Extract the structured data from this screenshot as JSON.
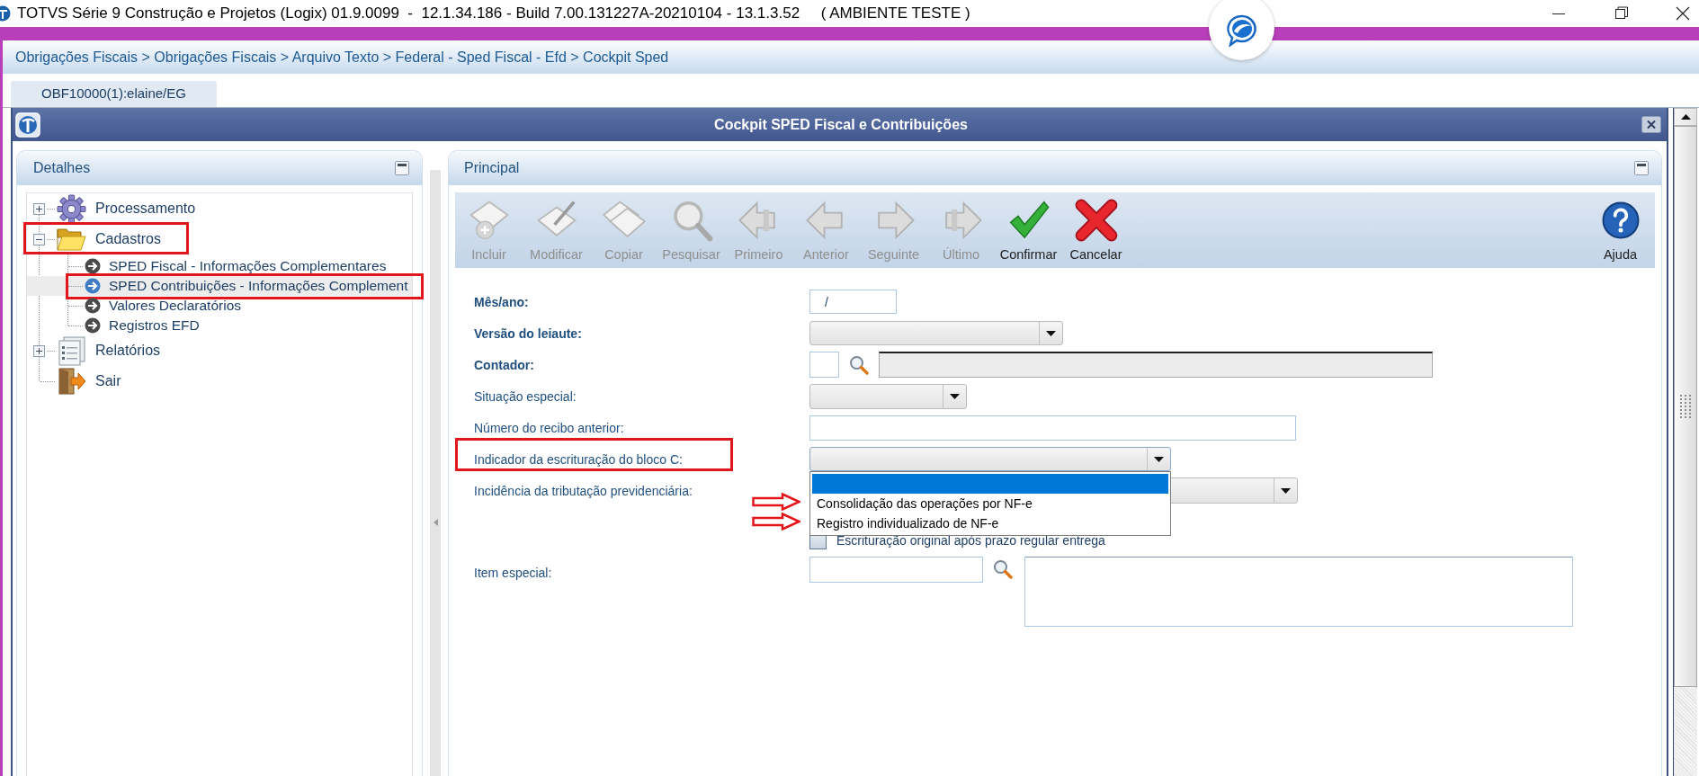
{
  "app_bar": {
    "title": "TOTVS Série 9 Construção e Projetos (Logix) 01.9.0099  -  12.1.34.186 - Build 7.00.131227A-20210104 - 13.1.3.52     ( AMBIENTE TESTE )"
  },
  "breadcrumb": "Obrigações Fiscais > Obrigações Fiscais > Arquivo Texto > Federal - Sped Fiscal - Efd > Cockpit Sped",
  "tabs": [
    {
      "label": "OBF10000(1):elaine/EG",
      "selected": true
    }
  ],
  "window": {
    "title": "Cockpit SPED Fiscal e Contribuições"
  },
  "details_panel": {
    "title": "Detalhes",
    "tree": [
      {
        "label": "Processamento",
        "expanded": false,
        "selected": false,
        "highlighted": false
      },
      {
        "label": "Cadastros",
        "expanded": true,
        "selected": false,
        "highlighted": true,
        "children": [
          {
            "label": "SPED Fiscal - Informações Complementares",
            "selected": false,
            "highlighted": false
          },
          {
            "label": "SPED Contribuições - Informações Complement",
            "selected": true,
            "highlighted": true
          },
          {
            "label": "Valores Declaratórios",
            "selected": false,
            "highlighted": false
          },
          {
            "label": "Registros EFD",
            "selected": false,
            "highlighted": false
          }
        ]
      },
      {
        "label": "Relatórios",
        "expanded": false,
        "selected": false,
        "highlighted": false
      },
      {
        "label": "Sair",
        "selected": false,
        "highlighted": false
      }
    ]
  },
  "main_panel": {
    "title": "Principal",
    "toolbar": [
      {
        "label": "Incluir",
        "disabled": true
      },
      {
        "label": "Modificar",
        "disabled": true
      },
      {
        "label": "Copiar",
        "disabled": true
      },
      {
        "label": "Pesquisar",
        "disabled": true
      },
      {
        "label": "Primeiro",
        "disabled": true
      },
      {
        "label": "Anterior",
        "disabled": true
      },
      {
        "label": "Seguinte",
        "disabled": true
      },
      {
        "label": "Último",
        "disabled": true
      },
      {
        "label": "Confirmar",
        "disabled": false
      },
      {
        "label": "Cancelar",
        "disabled": false
      }
    ],
    "help": {
      "label": "Ajuda",
      "disabled": false
    }
  },
  "form": {
    "fields": [
      {
        "kind": "text",
        "label": "Mês/ano:",
        "required": true,
        "highlighted": false,
        "value": "/"
      },
      {
        "kind": "select",
        "label": "Versão do leiaute:",
        "required": true,
        "highlighted": false,
        "expanded": false
      },
      {
        "kind": "lookup",
        "label": "Contador:",
        "required": true,
        "highlighted": false
      },
      {
        "kind": "select",
        "label": "Situação especial:",
        "required": false,
        "highlighted": false,
        "expanded": false
      },
      {
        "kind": "text",
        "label": "Número do recibo anterior:",
        "required": false,
        "highlighted": false
      },
      {
        "kind": "select",
        "label": "Indicador da escrituração do bloco C:",
        "required": false,
        "highlighted": true,
        "expanded": true,
        "options": [
          {
            "selected": true,
            "marked": false
          },
          {
            "label": "Consolidação das operações por NF-e",
            "selected": false,
            "marked": true
          },
          {
            "label": "Registro individualizado de NF-e",
            "selected": false,
            "marked": true
          }
        ]
      },
      {
        "kind": "select",
        "label": "Incidência da tributação previdenciária:",
        "required": false,
        "highlighted": false,
        "expanded": false
      },
      {
        "kind": "checkbox",
        "label": "Escrituração original após prazo regular entrega",
        "checked": false
      },
      {
        "kind": "lookup_memo",
        "label": "Item especial:",
        "required": false,
        "highlighted": false
      }
    ]
  }
}
